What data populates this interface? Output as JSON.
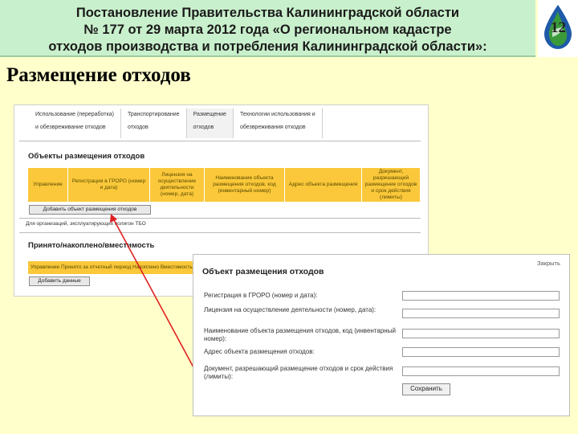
{
  "banner": {
    "line1": "Постановление Правительства Калининградской области",
    "line2": "№ 177 от 29 марта 2012 года «О региональном кадастре",
    "line3": "отходов производства и потребления Калининградской области»:"
  },
  "slide_number": "12",
  "heading": "Размещение отходов",
  "app": {
    "tabs": [
      {
        "line1": "Использование (переработка)",
        "line2": "и обезвреживание отходов"
      },
      {
        "line1": "Транспортирование",
        "line2": "отходов"
      },
      {
        "line1": "Размещение",
        "line2": "отходов"
      },
      {
        "line1": "Технологии использования и",
        "line2": "обезвреживания отходов"
      }
    ],
    "objects_section_title": "Объекты размещения отходов",
    "table_headers": [
      "Управление",
      "Регистрация в ГРОРО (номер и дата)",
      "Лицензия на осуществление деятельности (номер, дата)",
      "Наименование объекта размещения отходов, код (инвентарный номер)",
      "Адрес объекта размещения",
      "Документ, разрешающий размещение отходов и срок действия (лимиты)"
    ],
    "add_object_button": "Добавить объект размещения отходов",
    "org_note": "Для организаций, эксплуатирующих полигон ТБО",
    "accepted_section_title": "Принято/накоплено/вместимость",
    "accepted_row": "Управление  Принято за отчетный период  Накоплено  Вместимость",
    "add_data_button": "Добавить данные"
  },
  "form": {
    "title": "Объект размещения отходов",
    "close_label": "Закрыть",
    "fields": [
      "Регистрация в ГРОРО (номер и дата):",
      "Лицензия на осуществление деятельности (номер, дата):",
      "Наименование объекта размещения отходов, код (инвентарный номер):",
      "Адрес объекта размещения отходов:",
      "Документ, разрешающий размещение отходов и срок действия (лимиты):"
    ],
    "save_button": "Сохранить"
  },
  "colors": {
    "banner_bg": "#c9f0cc",
    "slide_bg": "#ffffcc",
    "table_header": "#fac83a",
    "arrow": "#e02020",
    "logo_blue": "#1e5aa8",
    "logo_green": "#3a9a3a"
  }
}
